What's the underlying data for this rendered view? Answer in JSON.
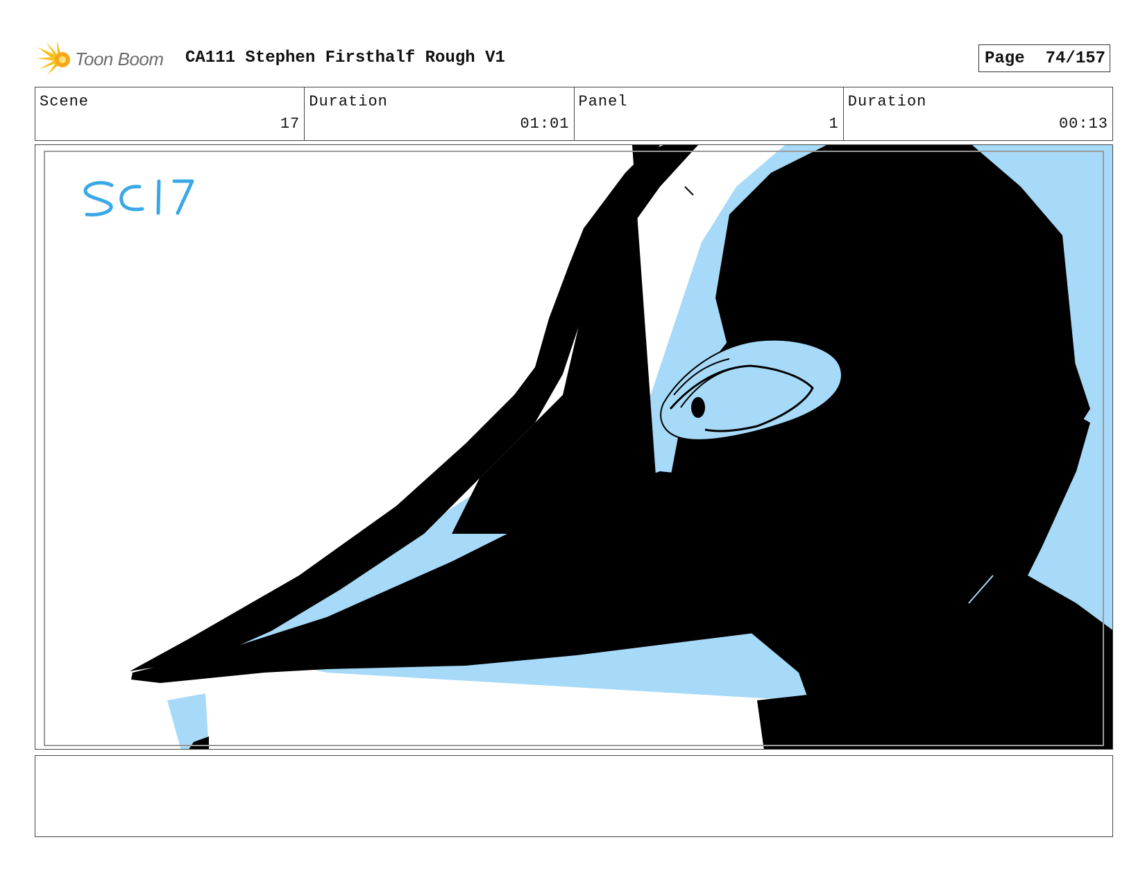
{
  "header": {
    "brand": "Toon Boom",
    "title": "CA111 Stephen Firsthalf Rough V1",
    "page_label": "Page",
    "page_value": "74/157"
  },
  "info": {
    "scene_label": "Scene",
    "scene_value": "17",
    "scene_duration_label": "Duration",
    "scene_duration_value": "01:01",
    "panel_label": "Panel",
    "panel_value": "1",
    "panel_duration_label": "Duration",
    "panel_duration_value": "00:13"
  },
  "panel": {
    "sketch_note": "SC 17"
  },
  "notes": {
    "text": ""
  },
  "colors": {
    "sky_blue": "#a6daf8",
    "note_blue": "#3aa8e8",
    "ink": "#000000",
    "logo_yellow": "#f5c21b"
  }
}
